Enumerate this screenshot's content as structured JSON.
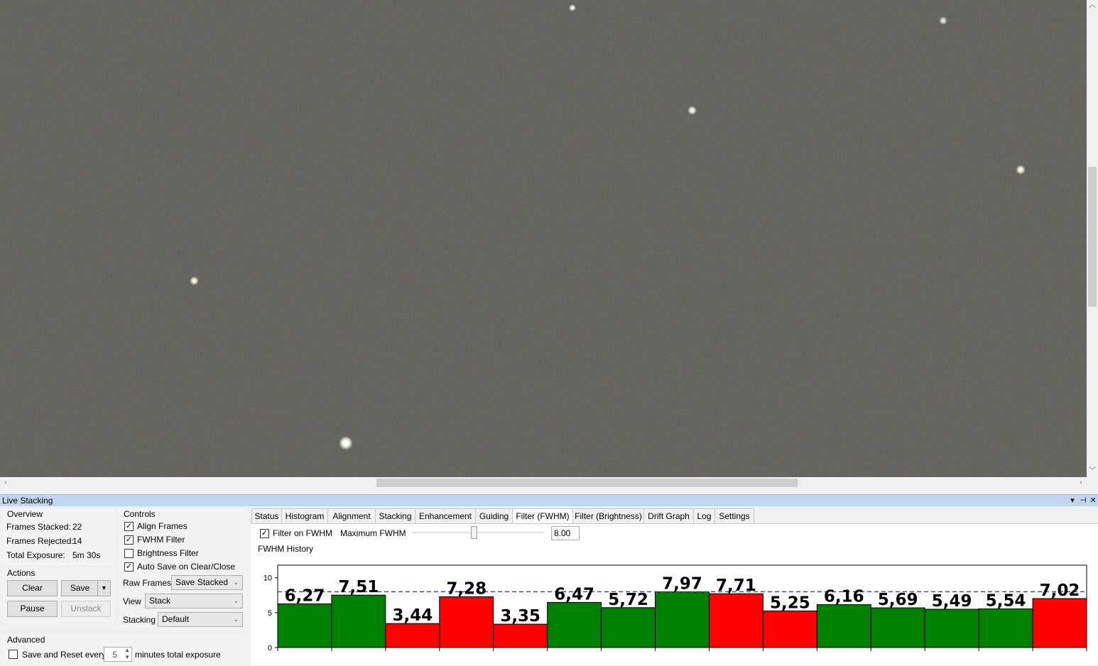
{
  "viewer": {
    "description_icon": "star-field-image"
  },
  "panel": {
    "title": "Live Stacking",
    "controls": [
      "dropdown-icon",
      "pin-icon",
      "close-icon"
    ]
  },
  "overview": {
    "heading": "Overview",
    "frames_stacked_label": "Frames Stacked:",
    "frames_stacked_value": "22",
    "frames_rejected_label": "Frames Rejected:",
    "frames_rejected_value": "14",
    "total_exposure_label": "Total Exposure:",
    "total_exposure_value": "5m 30s"
  },
  "actions": {
    "heading": "Actions",
    "clear": "Clear",
    "save": "Save",
    "pause": "Pause",
    "unstack": "Unstack"
  },
  "advanced": {
    "heading": "Advanced",
    "save_reset_label": "Save and Reset every",
    "minutes_value": "5",
    "minutes_suffix": "minutes total exposure"
  },
  "controls": {
    "heading": "Controls",
    "align_frames": "Align Frames",
    "fwhm_filter": "FWHM Filter",
    "brightness_filter": "Brightness Filter",
    "auto_save": "Auto Save on Clear/Close",
    "raw_frames_label": "Raw Frames",
    "raw_frames_value": "Save Stacked",
    "view_label": "View",
    "view_value": "Stack",
    "stacking_label": "Stacking",
    "stacking_value": "Default"
  },
  "tabs": [
    {
      "label": "Status"
    },
    {
      "label": "Histogram"
    },
    {
      "label": "Alignment"
    },
    {
      "label": "Stacking"
    },
    {
      "label": "Enhancement"
    },
    {
      "label": "Guiding"
    },
    {
      "label": "Filter (FWHM)"
    },
    {
      "label": "Filter (Brightness)"
    },
    {
      "label": "Drift Graph"
    },
    {
      "label": "Log"
    },
    {
      "label": "Settings"
    }
  ],
  "filter_fwhm": {
    "filter_on_label": "Filter on FWHM",
    "max_label": "Maximum FWHM",
    "max_value": "8.00",
    "slider_fraction": 0.47,
    "history_label": "FWHM History"
  },
  "colors": {
    "accepted": "#008000",
    "rejected": "#ff0000",
    "threshold_line": "#4a4a9a"
  },
  "chart_data": {
    "type": "bar",
    "values": [
      6.27,
      7.51,
      3.44,
      7.28,
      3.35,
      6.47,
      5.72,
      7.97,
      7.71,
      5.25,
      6.16,
      5.69,
      5.49,
      5.54,
      7.02
    ],
    "labels": [
      "6,27",
      "7,51",
      "3,44",
      "7,28",
      "3,35",
      "6,47",
      "5,72",
      "7,97",
      "7,71",
      "5,25",
      "6,16",
      "5,69",
      "5,49",
      "5,54",
      "7,02"
    ],
    "status": [
      "accepted",
      "accepted",
      "rejected",
      "rejected",
      "rejected",
      "accepted",
      "accepted",
      "accepted",
      "rejected",
      "rejected",
      "accepted",
      "accepted",
      "accepted",
      "accepted",
      "rejected"
    ],
    "y_ticks": [
      "0",
      "5",
      "10"
    ],
    "ylim": [
      0,
      11.8
    ],
    "threshold": 8.0
  }
}
